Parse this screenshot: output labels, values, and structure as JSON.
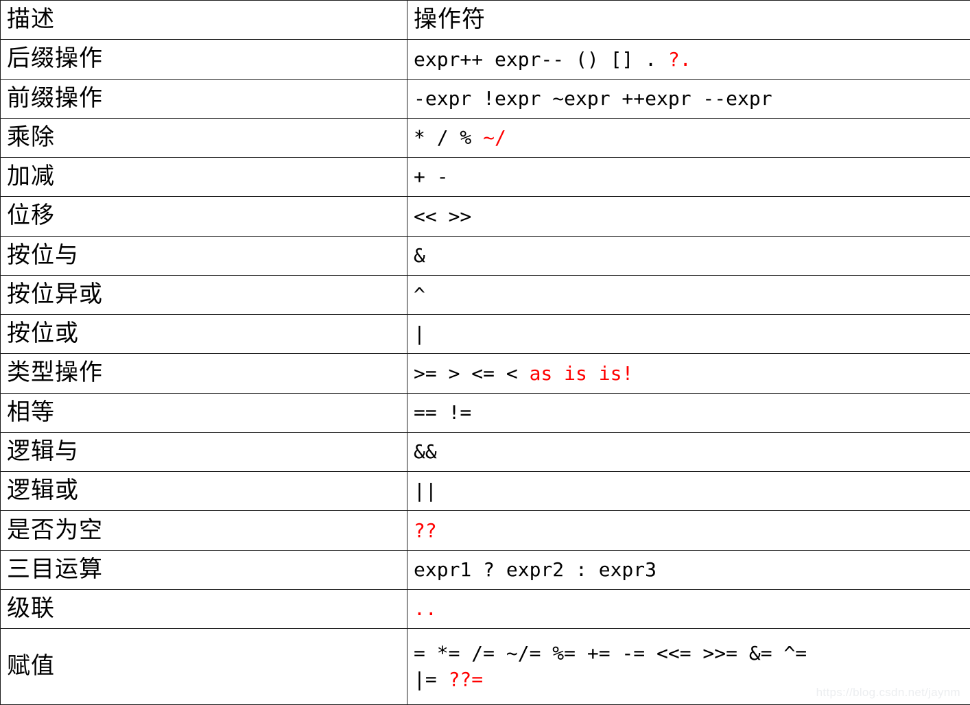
{
  "table": {
    "columns": [
      "描述",
      "操作符"
    ],
    "rows": [
      {
        "desc": "后缀操作",
        "lines": [
          {
            "black": "expr++ expr-- () [] . ",
            "red": "?."
          }
        ]
      },
      {
        "desc": "前缀操作",
        "lines": [
          {
            "black": "-expr !expr ~expr ++expr --expr",
            "red": ""
          }
        ]
      },
      {
        "desc": "乘除",
        "lines": [
          {
            "black": "* /  % ",
            "red": "~/"
          }
        ]
      },
      {
        "desc": "加减",
        "lines": [
          {
            "black": "+ -",
            "red": ""
          }
        ]
      },
      {
        "desc": "位移",
        "lines": [
          {
            "black": "<< >>",
            "red": ""
          }
        ]
      },
      {
        "desc": "按位与",
        "lines": [
          {
            "black": "&",
            "red": ""
          }
        ]
      },
      {
        "desc": "按位异或",
        "lines": [
          {
            "black": "^",
            "red": ""
          }
        ]
      },
      {
        "desc": "按位或",
        "lines": [
          {
            "black": "|",
            "red": ""
          }
        ]
      },
      {
        "desc": "类型操作",
        "lines": [
          {
            "black": ">= > <= < ",
            "red": "as is is!"
          }
        ]
      },
      {
        "desc": "相等",
        "lines": [
          {
            "black": "== !=",
            "red": ""
          }
        ]
      },
      {
        "desc": "逻辑与",
        "lines": [
          {
            "black": "&&",
            "red": ""
          }
        ]
      },
      {
        "desc": "逻辑或",
        "lines": [
          {
            "black": "||",
            "red": ""
          }
        ]
      },
      {
        "desc": "是否为空",
        "lines": [
          {
            "black": "",
            "red": "??"
          }
        ]
      },
      {
        "desc": "三目运算",
        "lines": [
          {
            "black": "expr1 ? expr2 : expr3",
            "red": ""
          }
        ]
      },
      {
        "desc": "级联",
        "lines": [
          {
            "black": "",
            "red": ".."
          }
        ]
      },
      {
        "desc": "赋值",
        "lines": [
          {
            "black": "= *= /= ~/= %= += -= <<= >>= &= ^=",
            "red": ""
          },
          {
            "black": "|= ",
            "red": "??="
          }
        ]
      }
    ]
  },
  "watermark": {
    "text": "https://blog.csdn.net/jaynm"
  },
  "colors": {
    "accent_red": "#ff0000",
    "text": "#000000",
    "border": "#1c1c1c",
    "background": "#ffffff",
    "watermark": "#eceef0"
  }
}
